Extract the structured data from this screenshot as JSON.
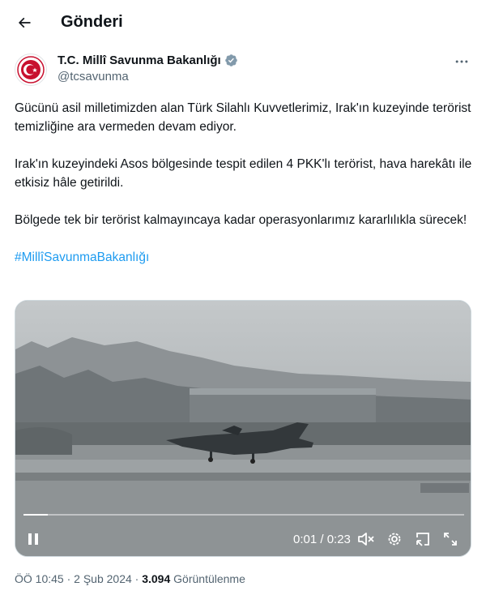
{
  "header": {
    "title": "Gönderi",
    "back_icon": "arrow-left-icon"
  },
  "author": {
    "display_name": "T.C. Millî Savunma Bakanlığı",
    "handle": "@tcsavunma",
    "verified_color": "#829aab",
    "avatar_color": "#c8102e"
  },
  "tweet": {
    "paragraphs": [
      "Gücünü asil milletimizden alan Türk Silahlı Kuvvetlerimiz, Irak'ın kuzeyinde terörist temizliğine ara vermeden devam ediyor.",
      "Irak'ın kuzeyindeki Asos bölgesinde tespit edilen 4 PKK'lı terörist, hava harekâtı ile etkisiz hâle getirildi.",
      "Bölgede tek bir terörist kalmayıncaya kadar operasyonlarımız kararlılıkla sürecek!"
    ],
    "hashtag": "#MillîSavunmaBakanlığı",
    "link_color": "#1d9bf0"
  },
  "video": {
    "progress": 0.055,
    "time_display": "0:01 / 0:23",
    "icons": [
      "pause-icon",
      "mute-icon",
      "settings-icon",
      "minimize-icon",
      "fullscreen-icon"
    ]
  },
  "meta": {
    "timestamp": "ÖÖ 10:45 · 2 Şub 2024",
    "separator": "·",
    "views_count": "3.094",
    "views_label": "Görüntülenme"
  }
}
